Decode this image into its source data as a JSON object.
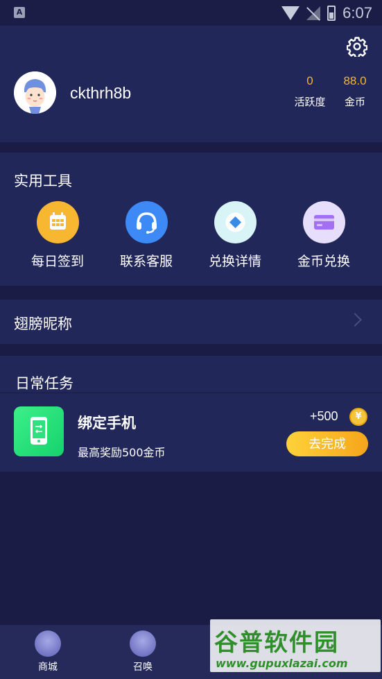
{
  "status_bar": {
    "time": "6:07",
    "notification_letter": "A"
  },
  "profile": {
    "username": "ckthrh8b",
    "stats": [
      {
        "value": "0",
        "label": "活跃度"
      },
      {
        "value": "88.0",
        "label": "金币"
      }
    ]
  },
  "tools": {
    "title": "实用工具",
    "items": [
      {
        "label": "每日签到",
        "icon": "calendar-icon",
        "color": "#f7b731"
      },
      {
        "label": "联系客服",
        "icon": "headset-icon",
        "color": "#3d8af7"
      },
      {
        "label": "兑换详情",
        "icon": "diamond-icon",
        "color": "#d9f4f7"
      },
      {
        "label": "金币兑换",
        "icon": "card-icon",
        "color": "#e6defa"
      }
    ]
  },
  "nickname_row": {
    "label": "翅膀昵称"
  },
  "daily_tasks": {
    "title": "日常任务",
    "task": {
      "title": "绑定手机",
      "description": "最高奖励500金币",
      "reward": "+500",
      "coin_symbol": "¥",
      "button_label": "去完成"
    }
  },
  "bottom_nav": {
    "items": [
      {
        "label": "商城"
      },
      {
        "label": "召唤"
      }
    ]
  },
  "watermark": {
    "brand": "谷普软件园",
    "url": "www.gupuxlazai.com"
  },
  "colors": {
    "background": "#1a1c45",
    "card": "#222759",
    "accent_gold": "#f5b52c",
    "task_green": "#16d26c",
    "button_yellow": "#f6a51b"
  }
}
